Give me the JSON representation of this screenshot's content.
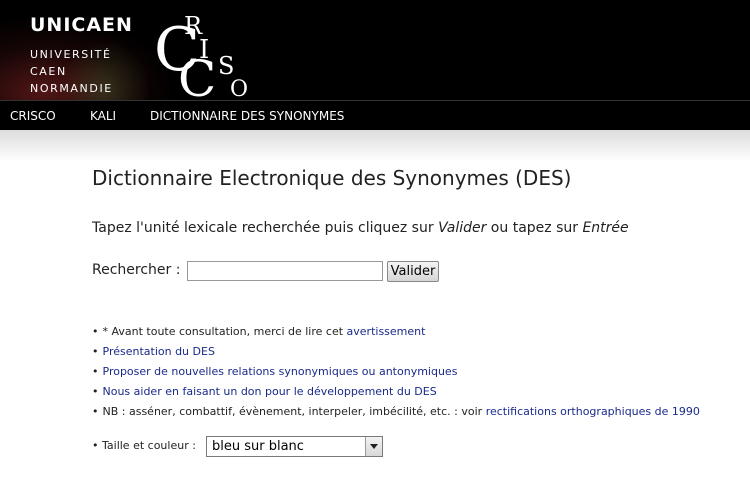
{
  "header": {
    "logo": {
      "mark": "UNICAEN",
      "lines": [
        "UNIVERSITÉ",
        "CAEN",
        "NORMANDIE"
      ]
    },
    "crisco_logo": {
      "letters": [
        "C",
        "R",
        "I",
        "S",
        "C",
        "O"
      ]
    }
  },
  "nav": {
    "items": [
      {
        "label": "CRISCO"
      },
      {
        "label": "KALI"
      },
      {
        "label": "DICTIONNAIRE DES SYNONYMES"
      }
    ]
  },
  "main": {
    "title": "Dictionnaire Electronique des Synonymes (DES)",
    "instruction": {
      "part1": "Tapez l'unité lexicale recherchée puis cliquez sur ",
      "valider": "Valider",
      "part2": " ou tapez sur ",
      "entree": "Entrée"
    },
    "search": {
      "label": "Rechercher :",
      "value": "",
      "placeholder": "",
      "button_label": "Valider"
    },
    "links": [
      {
        "bullet": "•",
        "prefix": "* Avant toute consultation, merci de lire cet ",
        "link": "avertissement"
      },
      {
        "bullet": "•",
        "prefix": "",
        "link": "Présentation du DES"
      },
      {
        "bullet": "•",
        "prefix": "",
        "link": "Proposer de nouvelles relations synonymiques ou antonymiques"
      },
      {
        "bullet": "•",
        "prefix": "",
        "link": "Nous aider en faisant un don pour le développement du DES"
      },
      {
        "bullet": "•",
        "prefix": "NB : asséner, combattif, évènement, interpeler, imbécilité, etc. : voir ",
        "link": "rectifications orthographiques de 1990"
      }
    ],
    "size_color": {
      "label": "Taille et couleur :",
      "selected": "bleu sur blanc"
    }
  },
  "colors": {
    "header_bg": "#000000",
    "link": "#1a2a8a",
    "text": "#222222"
  }
}
